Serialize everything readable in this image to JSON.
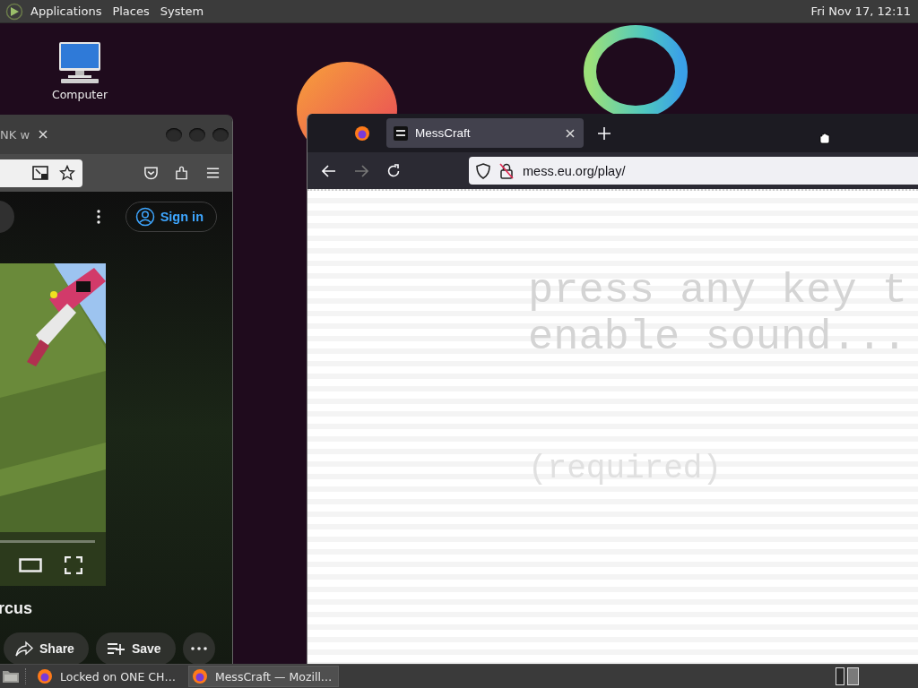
{
  "top_panel": {
    "menus": [
      "Applications",
      "Places",
      "System"
    ],
    "clock": "Fri Nov 17, 12:11"
  },
  "desktop_icons": [
    {
      "label": "Computer"
    }
  ],
  "back_window": {
    "tab_title": "NK w",
    "sign_in": "Sign in",
    "video": {
      "kind": "picture"
    },
    "video_title": "rcus",
    "actions": [
      "Share",
      "Save"
    ]
  },
  "front_window": {
    "tab_title": "MessCraft",
    "url": "mess.eu.org/play/",
    "message_lines": [
      "press any key t",
      "enable sound..."
    ],
    "note": "(required)"
  },
  "taskbar": {
    "items": [
      {
        "label": "Locked on ONE CH…",
        "selected": false
      },
      {
        "label": "MessCraft — Mozill…",
        "selected": true
      }
    ],
    "workspaces": [
      {
        "selected": false
      },
      {
        "selected": true
      }
    ]
  }
}
